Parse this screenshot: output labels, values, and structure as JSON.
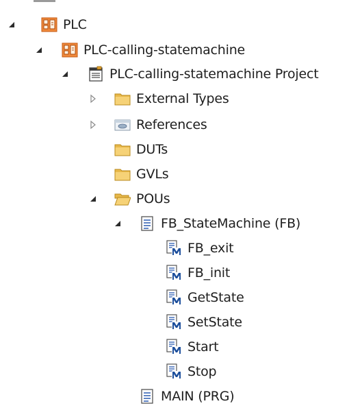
{
  "tree": {
    "nodes": [
      {
        "label": "PLC",
        "icon": "plc-icon",
        "expanded": true
      },
      {
        "label": "PLC-calling-statemachine",
        "icon": "plc-project-icon",
        "expanded": true
      },
      {
        "label": "PLC-calling-statemachine Project",
        "icon": "project-file-icon",
        "expanded": true
      },
      {
        "label": "External Types",
        "icon": "folder-icon",
        "expanded": false
      },
      {
        "label": "References",
        "icon": "references-icon",
        "expanded": false
      },
      {
        "label": "DUTs",
        "icon": "folder-icon"
      },
      {
        "label": "GVLs",
        "icon": "folder-icon"
      },
      {
        "label": "POUs",
        "icon": "folder-open-icon",
        "expanded": true
      },
      {
        "label": "FB_StateMachine (FB)",
        "icon": "pou-file-icon",
        "expanded": true
      },
      {
        "label": "FB_exit",
        "icon": "method-icon"
      },
      {
        "label": "FB_init",
        "icon": "method-icon"
      },
      {
        "label": "GetState",
        "icon": "method-icon"
      },
      {
        "label": "SetState",
        "icon": "method-icon"
      },
      {
        "label": "Start",
        "icon": "method-icon"
      },
      {
        "label": "Stop",
        "icon": "method-icon"
      },
      {
        "label": "MAIN (PRG)",
        "icon": "pou-file-icon"
      }
    ]
  },
  "colors": {
    "plc_orange": "#e0762c",
    "folder_yellow": "#f2c14e",
    "method_blue": "#1d4f9c",
    "twisty_dark": "#333333",
    "twisty_light": "#8a8a8a"
  }
}
